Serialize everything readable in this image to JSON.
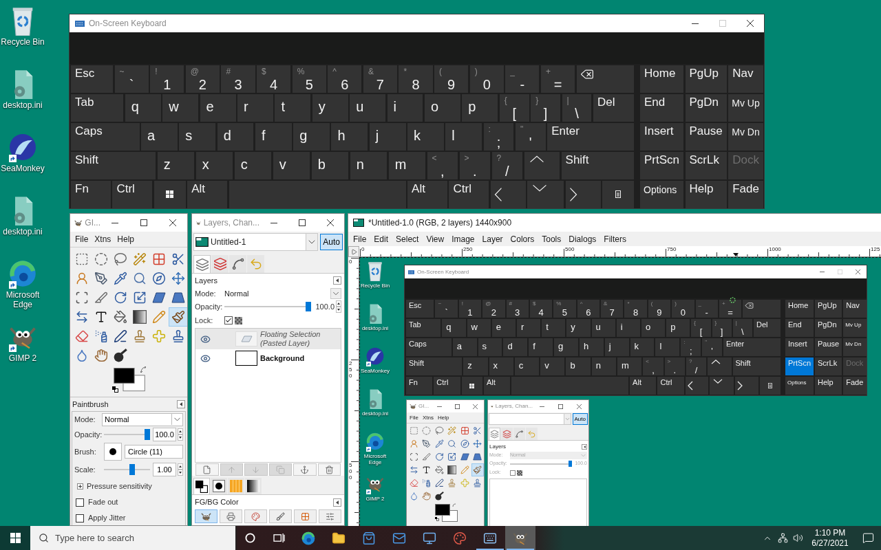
{
  "desktop_icons": [
    {
      "label": "Recycle Bin",
      "shortcut": false
    },
    {
      "label": "desktop.ini",
      "shortcut": false
    },
    {
      "label": "SeaMonkey",
      "shortcut": true
    },
    {
      "label": "desktop.ini",
      "shortcut": false
    },
    {
      "label": "Microsoft Edge",
      "shortcut": true
    },
    {
      "label": "GIMP 2",
      "shortcut": true
    }
  ],
  "keyboard": {
    "title": "On-Screen Keyboard",
    "active": false,
    "maximize_disabled": true,
    "rows": [
      {
        "keys": [
          {
            "kind": "label",
            "label": "Esc"
          },
          {
            "kind": "char",
            "shift": "~",
            "label": "`"
          },
          {
            "kind": "char",
            "shift": "!",
            "label": "1"
          },
          {
            "kind": "char",
            "shift": "@",
            "label": "2"
          },
          {
            "kind": "char",
            "shift": "#",
            "label": "3"
          },
          {
            "kind": "char",
            "shift": "$",
            "label": "4"
          },
          {
            "kind": "char",
            "shift": "%",
            "label": "5"
          },
          {
            "kind": "char",
            "shift": "^",
            "label": "6"
          },
          {
            "kind": "char",
            "shift": "&",
            "label": "7"
          },
          {
            "kind": "char",
            "shift": "*",
            "label": "8"
          },
          {
            "kind": "char",
            "shift": "(",
            "label": "9"
          },
          {
            "kind": "char",
            "shift": ")",
            "label": "0"
          },
          {
            "kind": "char",
            "shift": "_",
            "label": "-"
          },
          {
            "kind": "char",
            "shift": "+",
            "label": "="
          },
          {
            "kind": "backspace"
          }
        ]
      },
      {
        "keys": [
          {
            "kind": "label",
            "label": "Tab"
          },
          {
            "kind": "letter",
            "label": "q"
          },
          {
            "kind": "letter",
            "label": "w"
          },
          {
            "kind": "letter",
            "label": "e"
          },
          {
            "kind": "letter",
            "label": "r"
          },
          {
            "kind": "letter",
            "label": "t"
          },
          {
            "kind": "letter",
            "label": "y"
          },
          {
            "kind": "letter",
            "label": "u"
          },
          {
            "kind": "letter",
            "label": "i"
          },
          {
            "kind": "letter",
            "label": "o"
          },
          {
            "kind": "letter",
            "label": "p"
          },
          {
            "kind": "char",
            "shift": "{",
            "label": "["
          },
          {
            "kind": "char",
            "shift": "}",
            "label": "]"
          },
          {
            "kind": "char",
            "shift": "|",
            "label": "\\"
          },
          {
            "kind": "label",
            "label": "Del"
          }
        ]
      },
      {
        "keys": [
          {
            "kind": "label",
            "label": "Caps"
          },
          {
            "kind": "letter",
            "label": "a"
          },
          {
            "kind": "letter",
            "label": "s"
          },
          {
            "kind": "letter",
            "label": "d"
          },
          {
            "kind": "letter",
            "label": "f"
          },
          {
            "kind": "letter",
            "label": "g"
          },
          {
            "kind": "letter",
            "label": "h"
          },
          {
            "kind": "letter",
            "label": "j"
          },
          {
            "kind": "letter",
            "label": "k"
          },
          {
            "kind": "letter",
            "label": "l"
          },
          {
            "kind": "char",
            "shift": ":",
            "label": ";"
          },
          {
            "kind": "char",
            "shift": "\"",
            "label": "'"
          },
          {
            "kind": "label",
            "label": "Enter"
          }
        ]
      },
      {
        "keys": [
          {
            "kind": "label",
            "label": "Shift"
          },
          {
            "kind": "letter",
            "label": "z"
          },
          {
            "kind": "letter",
            "label": "x"
          },
          {
            "kind": "letter",
            "label": "c"
          },
          {
            "kind": "letter",
            "label": "v"
          },
          {
            "kind": "letter",
            "label": "b"
          },
          {
            "kind": "letter",
            "label": "n"
          },
          {
            "kind": "letter",
            "label": "m"
          },
          {
            "kind": "char",
            "shift": "<",
            "label": ","
          },
          {
            "kind": "char",
            "shift": ">",
            "label": "."
          },
          {
            "kind": "char",
            "shift": "?",
            "label": "/"
          },
          {
            "kind": "up"
          },
          {
            "kind": "label",
            "label": "Shift"
          }
        ]
      },
      {
        "keys": [
          {
            "kind": "label",
            "label": "Fn"
          },
          {
            "kind": "label",
            "label": "Ctrl"
          },
          {
            "kind": "win"
          },
          {
            "kind": "label",
            "label": "Alt"
          },
          {
            "kind": "space"
          },
          {
            "kind": "label",
            "label": "Alt"
          },
          {
            "kind": "label",
            "label": "Ctrl"
          },
          {
            "kind": "left"
          },
          {
            "kind": "down"
          },
          {
            "kind": "right"
          },
          {
            "kind": "menu"
          }
        ]
      }
    ],
    "nav_keys": [
      {
        "label": "Home",
        "kind": "label",
        "pressed": false,
        "disabled": false
      },
      {
        "label": "PgUp",
        "kind": "label",
        "pressed": false,
        "disabled": false
      },
      {
        "label": "Nav",
        "kind": "label",
        "pressed": false,
        "disabled": false
      },
      {
        "label": "End",
        "kind": "label",
        "pressed": false,
        "disabled": false
      },
      {
        "label": "PgDn",
        "kind": "label",
        "pressed": false,
        "disabled": false
      },
      {
        "label": "Mv Up",
        "kind": "compact",
        "pressed": false,
        "disabled": false
      },
      {
        "label": "Insert",
        "kind": "label",
        "pressed": false,
        "disabled": false
      },
      {
        "label": "Pause",
        "kind": "label",
        "pressed": false,
        "disabled": false
      },
      {
        "label": "Mv Dn",
        "kind": "compact",
        "pressed": false,
        "disabled": false
      },
      {
        "label": "PrtScn",
        "kind": "label",
        "pressed": false,
        "disabled": false
      },
      {
        "label": "ScrLk",
        "kind": "label",
        "pressed": false,
        "disabled": false
      },
      {
        "label": "Dock",
        "kind": "label",
        "pressed": false,
        "disabled": true
      },
      {
        "label": "Options",
        "kind": "compact",
        "pressed": false,
        "disabled": false
      },
      {
        "label": "Help",
        "kind": "label",
        "pressed": false,
        "disabled": false
      },
      {
        "label": "Fade",
        "kind": "label",
        "pressed": false,
        "disabled": false
      }
    ]
  },
  "toolbox": {
    "title": "GI...",
    "active": false,
    "menu": [
      "File",
      "Xtns",
      "Help"
    ],
    "tools": [
      {
        "selected": false
      },
      {
        "selected": false
      },
      {
        "selected": false
      },
      {
        "selected": false
      },
      {
        "selected": false
      },
      {
        "selected": false
      },
      {
        "selected": false
      },
      {
        "selected": false
      },
      {
        "selected": false
      },
      {
        "selected": false
      },
      {
        "selected": false
      },
      {
        "selected": false
      },
      {
        "selected": false
      },
      {
        "selected": false
      },
      {
        "selected": false
      },
      {
        "selected": false
      },
      {
        "selected": false
      },
      {
        "selected": false
      },
      {
        "selected": false
      },
      {
        "selected": false
      },
      {
        "selected": false
      },
      {
        "selected": false
      },
      {
        "selected": false
      },
      {
        "selected": true
      },
      {
        "selected": false
      },
      {
        "selected": false
      },
      {
        "selected": false
      },
      {
        "selected": false
      },
      {
        "selected": false
      },
      {
        "selected": false
      },
      {
        "selected": false
      },
      {
        "selected": false
      },
      {
        "selected": false
      }
    ],
    "tool_options": {
      "title": "Paintbrush",
      "mode_label": "Mode:",
      "mode": "Normal",
      "opacity_label": "Opacity:",
      "opacity": {
        "level": 1,
        "reading": "100.0"
      },
      "brush_label": "Brush:",
      "brush": "Circle (11)",
      "scale_label": "Scale:",
      "scale": {
        "level": 0.62,
        "reading": "1.00"
      },
      "pressure": {
        "label": "Pressure sensitivity",
        "expanded": false
      },
      "checks": [
        {
          "label": "Fade out",
          "checked": false
        },
        {
          "label": "Apply Jitter",
          "checked": false
        }
      ]
    }
  },
  "layers_dock": {
    "title": "Layers, Chan...",
    "active": false,
    "image": "Untitled-1",
    "auto": {
      "label": "Auto",
      "on": true
    },
    "tabs": [
      {
        "selected": true
      },
      {
        "selected": false
      },
      {
        "selected": false
      },
      {
        "selected": false
      }
    ],
    "panel_title": "Layers",
    "mode_label": "Mode:",
    "mode": "Normal",
    "opacity_label": "Opacity:",
    "opacity": {
      "level": 1,
      "reading": "100.0"
    },
    "lock_label": "Lock:",
    "lock_pixels": true,
    "disabled": false,
    "layers": [
      {
        "name": "Floating Selection (Pasted Layer)",
        "kind": "floating",
        "selected": true,
        "visible": true
      },
      {
        "name": "Background",
        "kind": "layer",
        "selected": false,
        "visible": true
      }
    ],
    "layer_buttons": [
      {
        "disabled": false
      },
      {
        "disabled": true
      },
      {
        "disabled": true
      },
      {
        "disabled": true
      },
      {
        "disabled": false
      },
      {
        "disabled": false
      }
    ],
    "bottom_tabs": [
      {
        "selected": true
      },
      {
        "selected": false
      },
      {
        "selected": false
      },
      {
        "selected": false
      }
    ],
    "bottom_title": "FG/BG Color",
    "bottom_buttons": [
      {
        "selected": true
      },
      {
        "selected": false
      },
      {
        "selected": false
      },
      {
        "selected": false
      },
      {
        "selected": false
      },
      {
        "selected": false
      }
    ]
  },
  "image_window": {
    "title": "*Untitled-1.0 (RGB, 2 layers) 1440x900",
    "active": true,
    "menu": [
      "File",
      "Edit",
      "Select",
      "View",
      "Image",
      "Layer",
      "Colors",
      "Tools",
      "Dialogs",
      "Filters"
    ],
    "hruler": [
      "0",
      "250",
      "500",
      "750",
      "1000",
      "125"
    ],
    "vruler": [
      "0",
      "250",
      "500"
    ],
    "canvas": {
      "desktop_icons": [
        {
          "label": "Recycle Bin",
          "shortcut": false
        },
        {
          "label": "desktop.ini",
          "shortcut": false
        },
        {
          "label": "SeaMonkey",
          "shortcut": true
        },
        {
          "label": "desktop.ini",
          "shortcut": false
        },
        {
          "label": "Microsoft Edge",
          "shortcut": true
        },
        {
          "label": "GIMP 2",
          "shortcut": true
        }
      ],
      "keyboard": {
        "title": "On-Screen Keyboard",
        "active": false,
        "maximize_disabled": true,
        "rows": [
          {
            "keys": [
              {
                "kind": "label",
                "label": "Esc"
              },
              {
                "kind": "char",
                "shift": "~",
                "label": "`"
              },
              {
                "kind": "char",
                "shift": "!",
                "label": "1"
              },
              {
                "kind": "char",
                "shift": "@",
                "label": "2"
              },
              {
                "kind": "char",
                "shift": "#",
                "label": "3"
              },
              {
                "kind": "char",
                "shift": "$",
                "label": "4"
              },
              {
                "kind": "char",
                "shift": "%",
                "label": "5"
              },
              {
                "kind": "char",
                "shift": "^",
                "label": "6"
              },
              {
                "kind": "char",
                "shift": "&",
                "label": "7"
              },
              {
                "kind": "char",
                "shift": "*",
                "label": "8"
              },
              {
                "kind": "char",
                "shift": "(",
                "label": "9"
              },
              {
                "kind": "char",
                "shift": ")",
                "label": "0"
              },
              {
                "kind": "char",
                "shift": "_",
                "label": "-"
              },
              {
                "kind": "char",
                "shift": "+",
                "label": "="
              },
              {
                "kind": "backspace"
              }
            ]
          },
          {
            "keys": [
              {
                "kind": "label",
                "label": "Tab"
              },
              {
                "kind": "letter",
                "label": "q"
              },
              {
                "kind": "letter",
                "label": "w"
              },
              {
                "kind": "letter",
                "label": "e"
              },
              {
                "kind": "letter",
                "label": "r"
              },
              {
                "kind": "letter",
                "label": "t"
              },
              {
                "kind": "letter",
                "label": "y"
              },
              {
                "kind": "letter",
                "label": "u"
              },
              {
                "kind": "letter",
                "label": "i"
              },
              {
                "kind": "letter",
                "label": "o"
              },
              {
                "kind": "letter",
                "label": "p"
              },
              {
                "kind": "char",
                "shift": "{",
                "label": "["
              },
              {
                "kind": "char",
                "shift": "}",
                "label": "]"
              },
              {
                "kind": "char",
                "shift": "|",
                "label": "\\"
              },
              {
                "kind": "label",
                "label": "Del"
              }
            ]
          },
          {
            "keys": [
              {
                "kind": "label",
                "label": "Caps"
              },
              {
                "kind": "letter",
                "label": "a"
              },
              {
                "kind": "letter",
                "label": "s"
              },
              {
                "kind": "letter",
                "label": "d"
              },
              {
                "kind": "letter",
                "label": "f"
              },
              {
                "kind": "letter",
                "label": "g"
              },
              {
                "kind": "letter",
                "label": "h"
              },
              {
                "kind": "letter",
                "label": "j"
              },
              {
                "kind": "letter",
                "label": "k"
              },
              {
                "kind": "letter",
                "label": "l"
              },
              {
                "kind": "char",
                "shift": ":",
                "label": ";"
              },
              {
                "kind": "char",
                "shift": "\"",
                "label": "'"
              },
              {
                "kind": "label",
                "label": "Enter"
              }
            ]
          },
          {
            "keys": [
              {
                "kind": "label",
                "label": "Shift"
              },
              {
                "kind": "letter",
                "label": "z"
              },
              {
                "kind": "letter",
                "label": "x"
              },
              {
                "kind": "letter",
                "label": "c"
              },
              {
                "kind": "letter",
                "label": "v"
              },
              {
                "kind": "letter",
                "label": "b"
              },
              {
                "kind": "letter",
                "label": "n"
              },
              {
                "kind": "letter",
                "label": "m"
              },
              {
                "kind": "char",
                "shift": "<",
                "label": ","
              },
              {
                "kind": "char",
                "shift": ">",
                "label": "."
              },
              {
                "kind": "char",
                "shift": "?",
                "label": "/"
              },
              {
                "kind": "up"
              },
              {
                "kind": "label",
                "label": "Shift"
              }
            ]
          },
          {
            "keys": [
              {
                "kind": "label",
                "label": "Fn"
              },
              {
                "kind": "label",
                "label": "Ctrl"
              },
              {
                "kind": "win"
              },
              {
                "kind": "label",
                "label": "Alt"
              },
              {
                "kind": "space"
              },
              {
                "kind": "label",
                "label": "Alt"
              },
              {
                "kind": "label",
                "label": "Ctrl"
              },
              {
                "kind": "left"
              },
              {
                "kind": "down"
              },
              {
                "kind": "right"
              },
              {
                "kind": "menu"
              }
            ]
          }
        ],
        "nav_keys": [
          {
            "label": "Home",
            "kind": "label",
            "pressed": false,
            "disabled": false
          },
          {
            "label": "PgUp",
            "kind": "label",
            "pressed": false,
            "disabled": false
          },
          {
            "label": "Nav",
            "kind": "label",
            "pressed": false,
            "disabled": false
          },
          {
            "label": "End",
            "kind": "label",
            "pressed": false,
            "disabled": false
          },
          {
            "label": "PgDn",
            "kind": "label",
            "pressed": false,
            "disabled": false
          },
          {
            "label": "Mv Up",
            "kind": "compact",
            "pressed": false,
            "disabled": false
          },
          {
            "label": "Insert",
            "kind": "label",
            "pressed": false,
            "disabled": false
          },
          {
            "label": "Pause",
            "kind": "label",
            "pressed": false,
            "disabled": false
          },
          {
            "label": "Mv Dn",
            "kind": "compact",
            "pressed": false,
            "disabled": false
          },
          {
            "label": "PrtScn",
            "kind": "label",
            "pressed": true,
            "disabled": false
          },
          {
            "label": "ScrLk",
            "kind": "label",
            "pressed": false,
            "disabled": false
          },
          {
            "label": "Dock",
            "kind": "label",
            "pressed": false,
            "disabled": true
          },
          {
            "label": "Options",
            "kind": "compact",
            "pressed": false,
            "disabled": false
          },
          {
            "label": "Help",
            "kind": "label",
            "pressed": false,
            "disabled": false
          },
          {
            "label": "Fade",
            "kind": "label",
            "pressed": false,
            "disabled": false
          }
        ]
      },
      "toolbox": {
        "title": "GI...",
        "active": false,
        "menu": [
          "File",
          "Xtns",
          "Help"
        ],
        "tools": [
          {
            "selected": false
          },
          {
            "selected": false
          },
          {
            "selected": false
          },
          {
            "selected": false
          },
          {
            "selected": false
          },
          {
            "selected": false
          },
          {
            "selected": false
          },
          {
            "selected": false
          },
          {
            "selected": false
          },
          {
            "selected": false
          },
          {
            "selected": false
          },
          {
            "selected": false
          },
          {
            "selected": false
          },
          {
            "selected": false
          },
          {
            "selected": false
          },
          {
            "selected": false
          },
          {
            "selected": false
          },
          {
            "selected": false
          },
          {
            "selected": false
          },
          {
            "selected": false
          },
          {
            "selected": false
          },
          {
            "selected": false
          },
          {
            "selected": false
          },
          {
            "selected": true
          },
          {
            "selected": false
          },
          {
            "selected": false
          },
          {
            "selected": false
          },
          {
            "selected": false
          },
          {
            "selected": false
          },
          {
            "selected": false
          },
          {
            "selected": false
          },
          {
            "selected": false
          },
          {
            "selected": false
          }
        ]
      },
      "layers_dock": {
        "title": "Layers, Chan...",
        "active": false,
        "auto": {
          "label": "Auto",
          "on": true
        },
        "tabs": [
          {
            "selected": true
          },
          {
            "selected": false
          },
          {
            "selected": false
          },
          {
            "selected": false
          }
        ],
        "panel_title": "Layers",
        "mode_label": "Mode:",
        "mode": "Normal",
        "opacity_label": "Opacity:",
        "opacity": {
          "level": 1,
          "reading": "100.0"
        },
        "lock_label": "Lock:",
        "lock_pixels": false,
        "disabled": true
      }
    }
  },
  "taskbar": {
    "search_placeholder": "Type here to search",
    "apps": [
      {
        "running": false,
        "selected": false
      },
      {
        "running": false,
        "selected": false
      },
      {
        "running": false,
        "selected": false
      },
      {
        "running": false,
        "selected": false
      },
      {
        "running": false,
        "selected": false
      },
      {
        "running": false,
        "selected": false
      },
      {
        "running": true,
        "selected": false
      },
      {
        "running": true,
        "selected": true
      }
    ],
    "time": "1:10 PM",
    "date": "6/27/2021"
  }
}
